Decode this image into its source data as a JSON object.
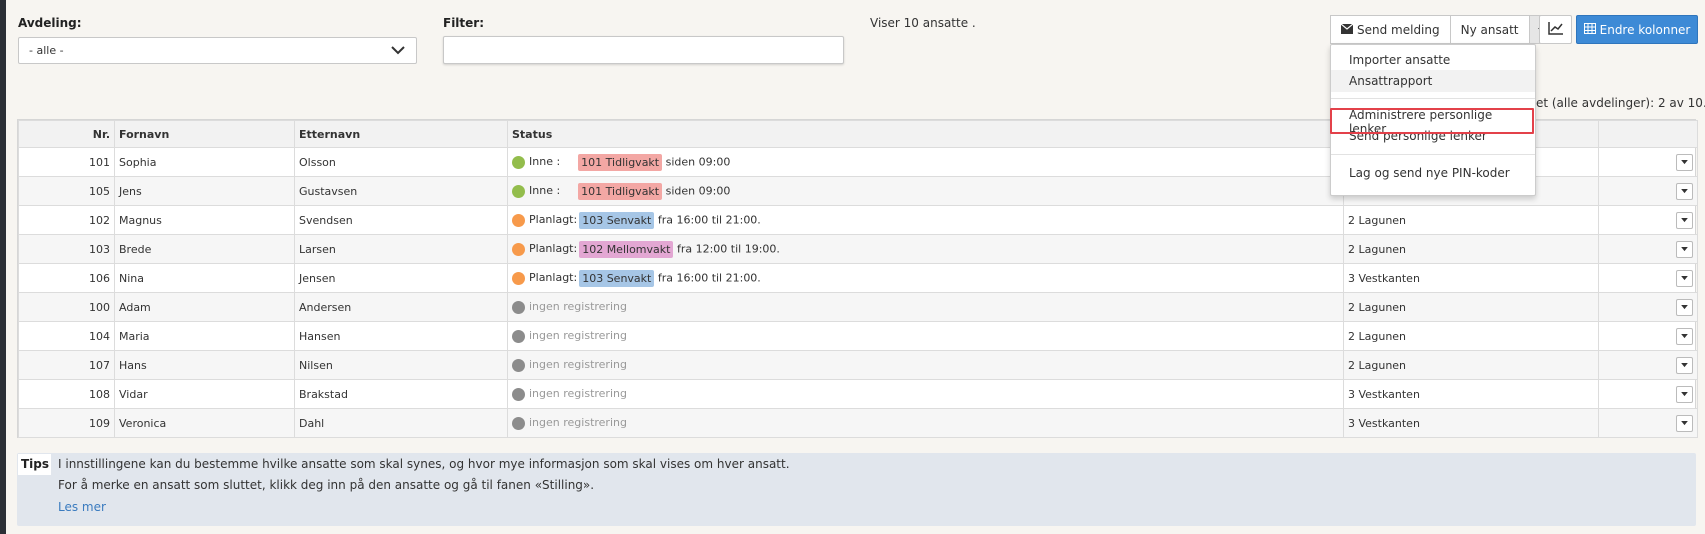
{
  "department": {
    "label": "Avdeling:",
    "selected": "- alle -"
  },
  "filter": {
    "label": "Filter:",
    "value": ""
  },
  "count_text": "Viser 10 ansatte .",
  "toolbar": {
    "send_message": "Send melding",
    "new_employee": "Ny ansatt",
    "change_columns": "Endre kolonner",
    "complete_text": "plet (alle avdelinger): 2 av 10."
  },
  "dropdown": {
    "items": [
      "Importer ansatte",
      "Ansattrapport",
      "Administrere personlige lenker",
      "Send personlige lenker",
      "Lag og send nye PIN-koder"
    ]
  },
  "table": {
    "headers": [
      "Nr.",
      "Fornavn",
      "Etternavn",
      "Status",
      "",
      ""
    ],
    "rows": [
      {
        "nr": "101",
        "first": "Sophia",
        "last": "Olsson",
        "state": "in",
        "prefix": "Inne :",
        "tag": "101 Tidligvakt",
        "detail": "siden 09:00",
        "dept": ""
      },
      {
        "nr": "105",
        "first": "Jens",
        "last": "Gustavsen",
        "state": "in",
        "prefix": "Inne :",
        "tag": "101 Tidligvakt",
        "detail": "siden 09:00",
        "dept": ""
      },
      {
        "nr": "102",
        "first": "Magnus",
        "last": "Svendsen",
        "state": "planned",
        "prefix": "Planlagt:",
        "tag": "103 Senvakt",
        "detail": "fra 16:00 til 21:00.",
        "dept": "2 Lagunen"
      },
      {
        "nr": "103",
        "first": "Brede",
        "last": "Larsen",
        "state": "planned",
        "prefix": "Planlagt:",
        "tag": "102 Mellomvakt",
        "detail": "fra 12:00 til 19:00.",
        "dept": "2 Lagunen"
      },
      {
        "nr": "106",
        "first": "Nina",
        "last": "Jensen",
        "state": "planned",
        "prefix": "Planlagt:",
        "tag": "103 Senvakt",
        "detail": "fra 16:00 til 21:00.",
        "dept": "3 Vestkanten"
      },
      {
        "nr": "100",
        "first": "Adam",
        "last": "Andersen",
        "state": "none",
        "prefix": "",
        "tag": "",
        "detail": "ingen registrering",
        "dept": "2 Lagunen"
      },
      {
        "nr": "104",
        "first": "Maria",
        "last": "Hansen",
        "state": "none",
        "prefix": "",
        "tag": "",
        "detail": "ingen registrering",
        "dept": "2 Lagunen"
      },
      {
        "nr": "107",
        "first": "Hans",
        "last": "Nilsen",
        "state": "none",
        "prefix": "",
        "tag": "",
        "detail": "ingen registrering",
        "dept": "2 Lagunen"
      },
      {
        "nr": "108",
        "first": "Vidar",
        "last": "Brakstad",
        "state": "none",
        "prefix": "",
        "tag": "",
        "detail": "ingen registrering",
        "dept": "3 Vestkanten"
      },
      {
        "nr": "109",
        "first": "Veronica",
        "last": "Dahl",
        "state": "none",
        "prefix": "",
        "tag": "",
        "detail": "ingen registrering",
        "dept": "3 Vestkanten"
      }
    ]
  },
  "colors": {
    "in": "#93bd4c",
    "planned": "#f79a4b",
    "none": "#8c8c8c",
    "tag_101 Tidligvakt": "#f3a7a4",
    "tag_102 Mellomvakt": "#e3a7d3",
    "tag_103 Senvakt": "#a6c6e6"
  },
  "tips": {
    "label": "Tips",
    "line1": "I innstillingene kan du bestemme hvilke ansatte som skal synes, og hvor mye informasjon som skal vises om hver ansatt.",
    "line2": "For å merke en ansatt som sluttet, klikk deg inn på den ansatte og gå til fanen «Stilling».",
    "link": "Les mer"
  }
}
